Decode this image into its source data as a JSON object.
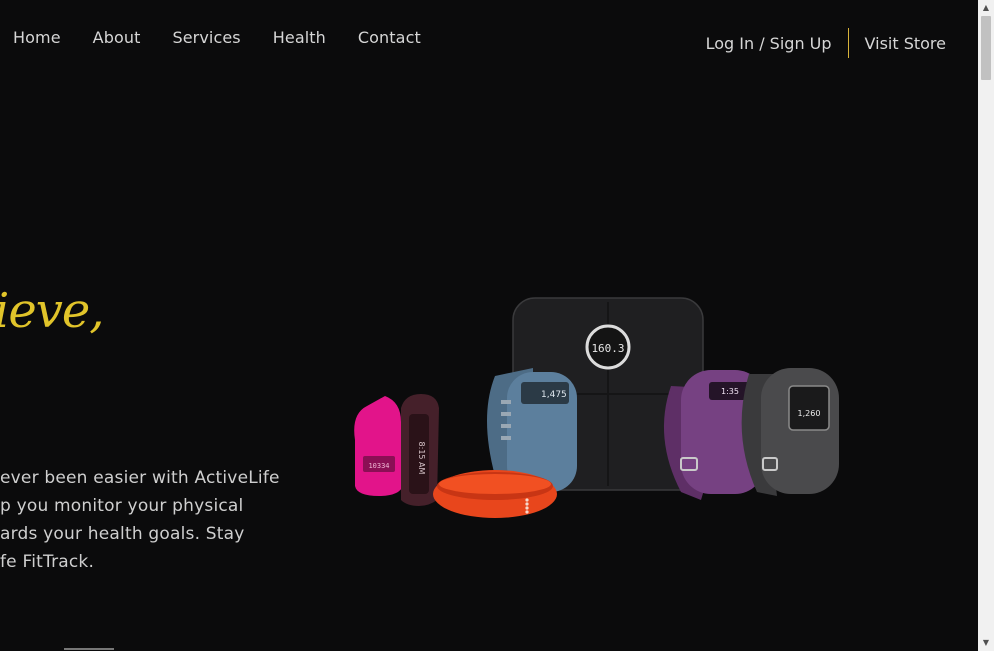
{
  "nav": {
    "links": [
      "Home",
      "About",
      "Services",
      "Health",
      "Contact"
    ],
    "login": "Log In / Sign Up",
    "store": "Visit Store"
  },
  "hero": {
    "heading": "ieve,",
    "copy_lines": [
      "ever been easier with ActiveLife",
      "p you monitor your physical",
      "ards your health goals. Stay",
      "fe FitTrack."
    ]
  },
  "products": {
    "scale_reading": "160.3",
    "blue_band_reading": "1,475",
    "purple_band_reading": "1:35",
    "black_watch_reading": "1,260",
    "clip_reading": "10334",
    "flex_reading": "8:15 AM"
  },
  "colors": {
    "accent": "#e1c42a",
    "background": "#0b0b0c",
    "divider": "#d8b33a"
  }
}
